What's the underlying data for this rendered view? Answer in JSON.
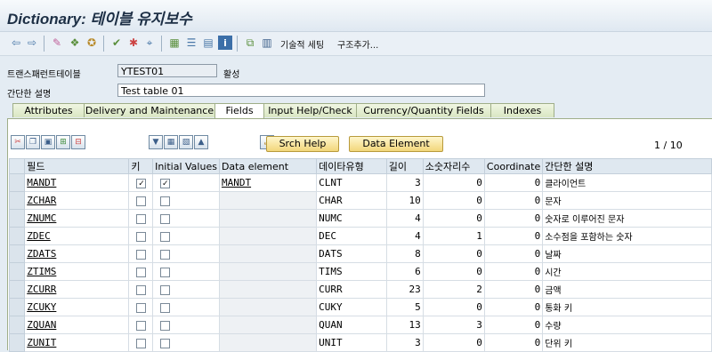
{
  "title": "Dictionary: 테이블 유지보수",
  "toolbar": {
    "icons": [
      "back-icon",
      "forward-icon",
      "display-change-icon",
      "other-object-icon",
      "activate-icon",
      "check-icon",
      "activate-icon-2",
      "where-used-icon",
      "navigate-icon",
      "object-list-icon",
      "display-object-list-icon",
      "info-icon",
      "hierarchy-icon",
      "grid-icon"
    ],
    "tech_settings": "기술적 세팅",
    "append_structure": "구조추가..."
  },
  "form": {
    "table_label": "트랜스패런트테이블",
    "table_value": "YTEST01",
    "status": "활성",
    "desc_label": "간단한 설명",
    "desc_value": "Test table 01"
  },
  "tabs": [
    "Attributes",
    "Delivery and Maintenance",
    "Fields",
    "Input Help/Check",
    "Currency/Quantity Fields",
    "Indexes"
  ],
  "active_tab": "Fields",
  "table_toolbar": {
    "srch_help": "Srch Help",
    "data_element": "Data Element",
    "page": "1",
    "page_sep": "/",
    "page_total": "10"
  },
  "columns": [
    "필드",
    "키",
    "Initial Values",
    "Data element",
    "데이타유형",
    "길이",
    "소숫자리수",
    "Coordinate",
    "간단한 설명"
  ],
  "rows": [
    {
      "field": "MANDT",
      "key": true,
      "init": true,
      "elem": "MANDT",
      "type": "CLNT",
      "len": "3",
      "dec": "0",
      "coord": "0",
      "desc": "클라이언트"
    },
    {
      "field": "ZCHAR",
      "key": false,
      "init": false,
      "elem": "",
      "type": "CHAR",
      "len": "10",
      "dec": "0",
      "coord": "0",
      "desc": "문자"
    },
    {
      "field": "ZNUMC",
      "key": false,
      "init": false,
      "elem": "",
      "type": "NUMC",
      "len": "4",
      "dec": "0",
      "coord": "0",
      "desc": "숫자로 이루어진 문자"
    },
    {
      "field": "ZDEC",
      "key": false,
      "init": false,
      "elem": "",
      "type": "DEC",
      "len": "4",
      "dec": "1",
      "coord": "0",
      "desc": "소수점을 포함하는 숫자"
    },
    {
      "field": "ZDATS",
      "key": false,
      "init": false,
      "elem": "",
      "type": "DATS",
      "len": "8",
      "dec": "0",
      "coord": "0",
      "desc": "날짜"
    },
    {
      "field": "ZTIMS",
      "key": false,
      "init": false,
      "elem": "",
      "type": "TIMS",
      "len": "6",
      "dec": "0",
      "coord": "0",
      "desc": "시간"
    },
    {
      "field": "ZCURR",
      "key": false,
      "init": false,
      "elem": "",
      "type": "CURR",
      "len": "23",
      "dec": "2",
      "coord": "0",
      "desc": "금액"
    },
    {
      "field": "ZCUKY",
      "key": false,
      "init": false,
      "elem": "",
      "type": "CUKY",
      "len": "5",
      "dec": "0",
      "coord": "0",
      "desc": "통화 키"
    },
    {
      "field": "ZQUAN",
      "key": false,
      "init": false,
      "elem": "",
      "type": "QUAN",
      "len": "13",
      "dec": "3",
      "coord": "0",
      "desc": "수량"
    },
    {
      "field": "ZUNIT",
      "key": false,
      "init": false,
      "elem": "",
      "type": "UNIT",
      "len": "3",
      "dec": "0",
      "coord": "0",
      "desc": "단위 키"
    }
  ]
}
